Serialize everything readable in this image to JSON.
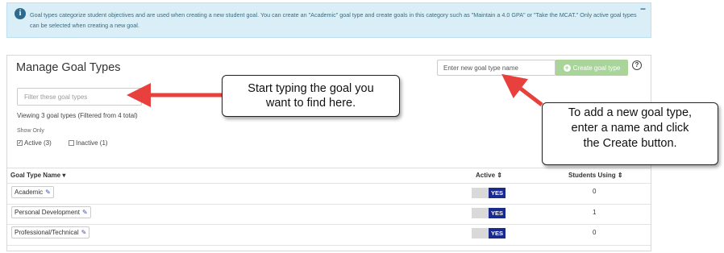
{
  "info": {
    "text": "Goal types categorize student objectives and are used when creating a new student goal. You can create an \"Academic\" goal type and create goals in this category such as \"Maintain a 4.0 GPA\" or \"Take the MCAT.\" Only active goal types can be selected when creating a new goal.",
    "collapse_label": "−"
  },
  "panel": {
    "title": "Manage Goal Types",
    "filter_placeholder": "Filter these goal types",
    "viewing_text": "Viewing 3 goal types (Filtered from 4 total)",
    "show_only_label": "Show Only",
    "active_option": "Active (3)",
    "inactive_option": "Inactive (1)",
    "active_checked": true,
    "inactive_checked": false,
    "new_goal_placeholder": "Enter new goal type name",
    "create_button": "Create goal type",
    "help_label": "?"
  },
  "table": {
    "headers": {
      "name": "Goal Type Name ▾",
      "active": "Active ⇕",
      "students": "Students Using ⇕"
    },
    "rows": [
      {
        "name": "Academic",
        "active": "YES",
        "students": "0"
      },
      {
        "name": "Personal Development",
        "active": "YES",
        "students": "1"
      },
      {
        "name": "Professional/Technical",
        "active": "YES",
        "students": "0"
      }
    ]
  },
  "callouts": {
    "filter_hint_line1": "Start typing the goal you",
    "filter_hint_line2": "want to find here.",
    "create_hint_line1": "To add a new goal type,",
    "create_hint_line2": "enter a name and click",
    "create_hint_line3": "the Create button."
  },
  "colors": {
    "info_bg": "#daeef7",
    "create_button": "#a9d49a",
    "toggle_yes": "#1b2a8e",
    "arrow": "#e8403c"
  }
}
